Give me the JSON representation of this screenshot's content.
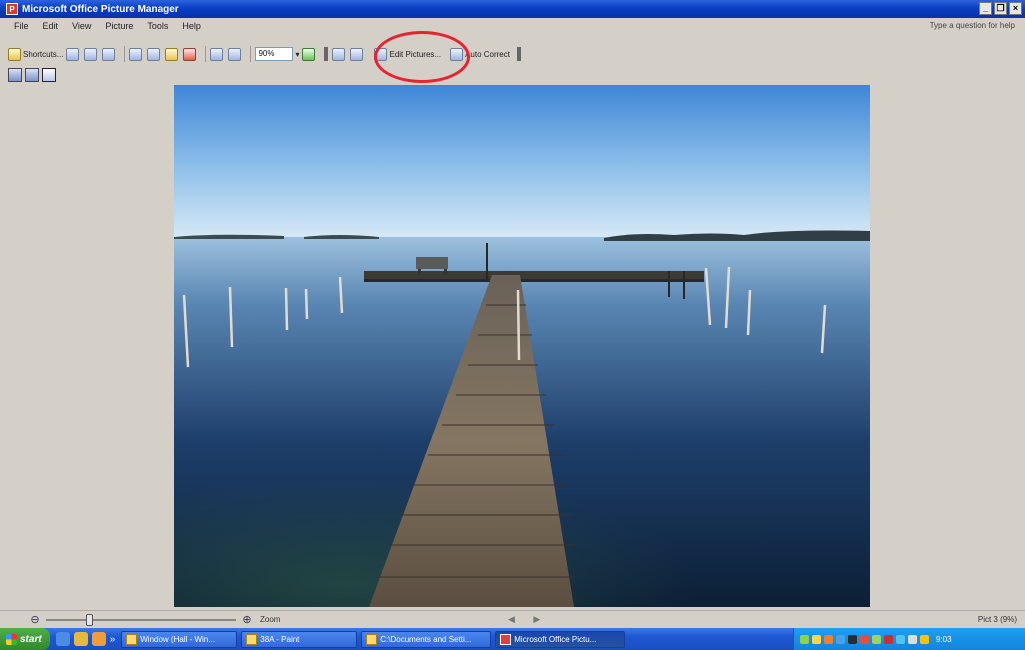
{
  "window": {
    "title": "Microsoft Office Picture Manager",
    "app_icon_glyph": "P"
  },
  "menu": {
    "items": [
      "File",
      "Edit",
      "View",
      "Picture",
      "Tools",
      "Help"
    ],
    "help_search": "Type a question for help"
  },
  "toolbar": {
    "shortcuts_label": "Shortcuts...",
    "zoom_value": "90%",
    "edit_pictures_label": "Edit Pictures...",
    "auto_correct_label": "Auto Correct"
  },
  "statusbar": {
    "zoom_label": "Zoom",
    "zoom_level": 0.22,
    "nav": "◀ ▶",
    "right_text": "Pict 3 (9%)"
  },
  "taskbar": {
    "start_label": "start",
    "more": "»",
    "tasks": [
      {
        "label": "Window (Hall - Win...",
        "width": 116,
        "icon": "ie"
      },
      {
        "label": "38A - Paint",
        "width": 116,
        "icon": "paint"
      },
      {
        "label": "C:\\Documents and Setti...",
        "width": 130,
        "icon": "folder"
      },
      {
        "label": "Microsoft Office Pictu...",
        "width": 130,
        "icon": "picture-manager",
        "active": true
      }
    ],
    "clock": "9:03"
  },
  "colors": {
    "titlebar": "#0a3fc4",
    "highlight_ring": "#e8232f",
    "taskbar": "#1f58d3",
    "start": "#2f8a2b"
  }
}
